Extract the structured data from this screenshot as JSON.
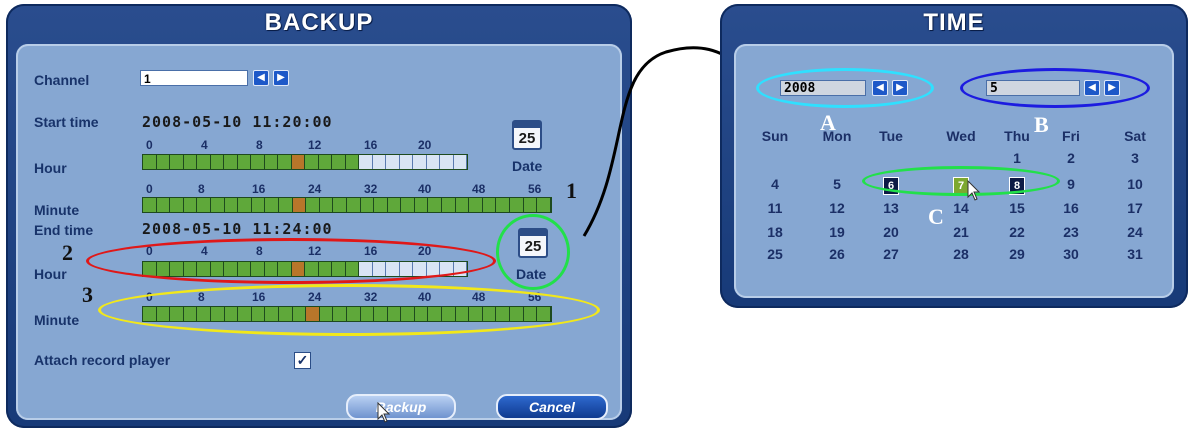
{
  "backup": {
    "title": "BACKUP",
    "channel_label": "Channel",
    "channel_value": "1",
    "start_label": "Start time",
    "start_value": "2008-05-10  11:20:00",
    "hour_label": "Hour",
    "minute_label": "Minute",
    "end_label": "End time",
    "end_value": "2008-05-10  11:24:00",
    "hour_ticks": [
      "0",
      "4",
      "8",
      "12",
      "16",
      "20"
    ],
    "minute_ticks": [
      "0",
      "8",
      "16",
      "24",
      "32",
      "40",
      "48",
      "56"
    ],
    "date_icon_num": "25",
    "date_label": "Date",
    "attach_label": "Attach record player",
    "attach_checked": "✓",
    "backup_button": "Backup",
    "cancel_button": "Cancel",
    "arrow_left": "◀",
    "arrow_right": "▶"
  },
  "annotations": {
    "one": "1",
    "two": "2",
    "three": "3",
    "a": "A",
    "b": "B",
    "c": "C"
  },
  "time": {
    "title": "TIME",
    "year_value": "2008",
    "month_value": "5",
    "weekdays": [
      "Sun",
      "Mon",
      "Tue",
      "Wed",
      "Thu",
      "Fri",
      "Sat"
    ],
    "weeks": [
      [
        "",
        "",
        "",
        "",
        "1",
        "2",
        "3"
      ],
      [
        "4",
        "5",
        "6",
        "7",
        "8",
        "9",
        "10"
      ],
      [
        "11",
        "12",
        "13",
        "14",
        "15",
        "16",
        "17"
      ],
      [
        "18",
        "19",
        "20",
        "21",
        "22",
        "23",
        "24"
      ],
      [
        "25",
        "26",
        "27",
        "28",
        "29",
        "30",
        "31"
      ]
    ],
    "boxed_days": [
      "6",
      "8"
    ],
    "selected_day": "7"
  },
  "colors": {
    "ring_cyan": "#2fe0ff",
    "ring_blue": "#1c1ce0",
    "ring_green": "#22e04a",
    "ring_red": "#e01818",
    "ring_yellow": "#f2e81a",
    "record_green": "#5fa83a",
    "panel_blue": "#2a4d8e"
  }
}
